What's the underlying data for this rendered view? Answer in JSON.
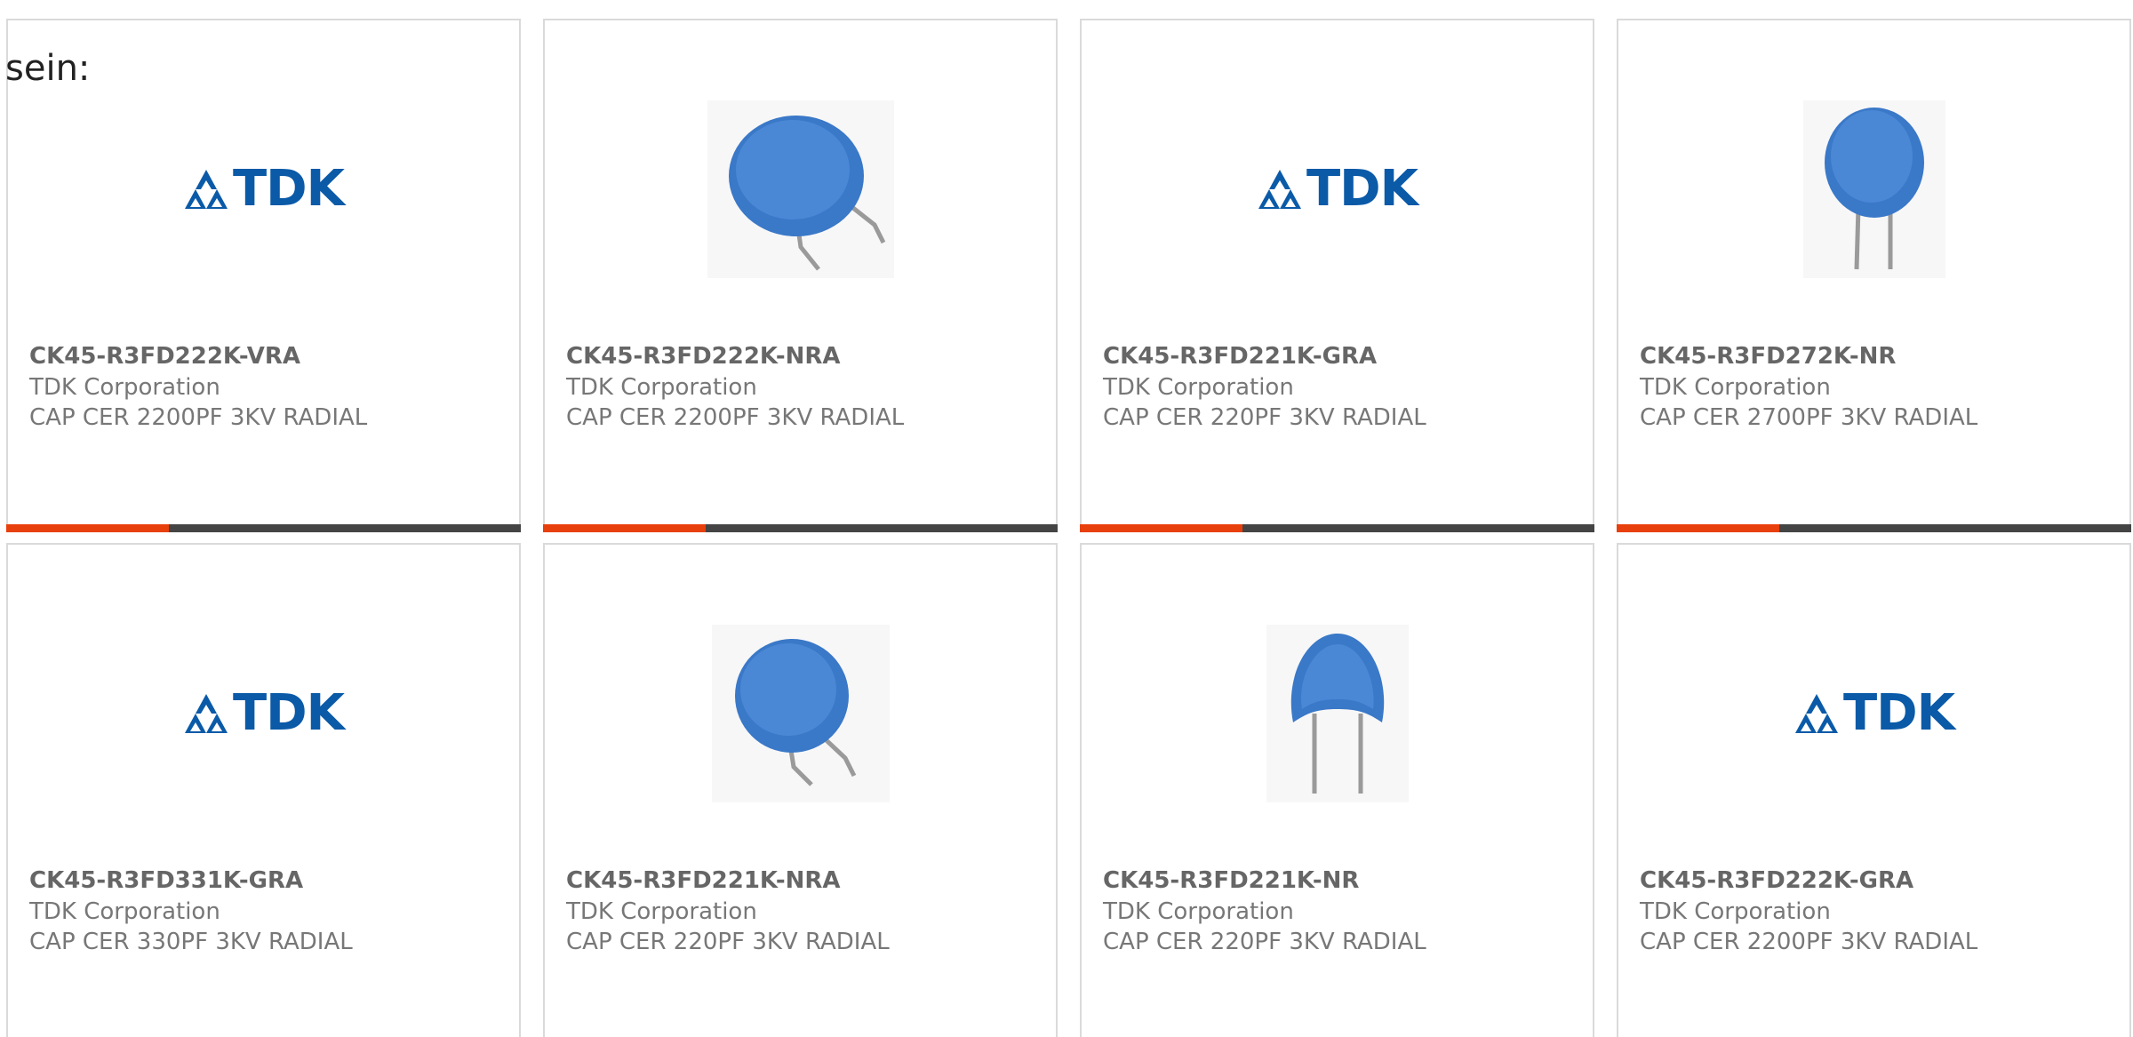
{
  "intro_text": "sein:",
  "cards": [
    {
      "part": "CK45-R3FD222K-VRA",
      "maker": "TDK Corporation",
      "desc": "CAP CER 2200PF 3KV RADIAL",
      "image": "tdk-logo",
      "brand_text": "TDK",
      "accent": "#e8400c"
    },
    {
      "part": "CK45-R3FD222K-NRA",
      "maker": "TDK Corporation",
      "desc": "CAP CER 2200PF 3KV RADIAL",
      "image": "disc-capacitor-tilted"
    },
    {
      "part": "CK45-R3FD221K-GRA",
      "maker": "TDK Corporation",
      "desc": "CAP CER 220PF 3KV RADIAL",
      "image": "tdk-logo",
      "brand_text": "TDK"
    },
    {
      "part": "CK45-R3FD272K-NR",
      "maker": "TDK Corporation",
      "desc": "CAP CER 2700PF 3KV RADIAL",
      "image": "disc-capacitor-upright"
    },
    {
      "part": "CK45-R3FD331K-GRA",
      "maker": "TDK Corporation",
      "desc": "CAP CER 330PF 3KV RADIAL",
      "image": "tdk-logo",
      "brand_text": "TDK"
    },
    {
      "part": "CK45-R3FD221K-NRA",
      "maker": "TDK Corporation",
      "desc": "CAP CER 220PF 3KV RADIAL",
      "image": "disc-capacitor-tilted"
    },
    {
      "part": "CK45-R3FD221K-NR",
      "maker": "TDK Corporation",
      "desc": "CAP CER 220PF 3KV RADIAL",
      "image": "disc-capacitor-upright-small"
    },
    {
      "part": "CK45-R3FD222K-GRA",
      "maker": "TDK Corporation",
      "desc": "CAP CER 2200PF 3KV RADIAL",
      "image": "tdk-logo",
      "brand_text": "TDK"
    }
  ],
  "colors": {
    "accent": "#e8400c",
    "bar": "#444444",
    "tdk_blue": "#0a5aa8",
    "capacitor_blue": "#3a78c8"
  }
}
